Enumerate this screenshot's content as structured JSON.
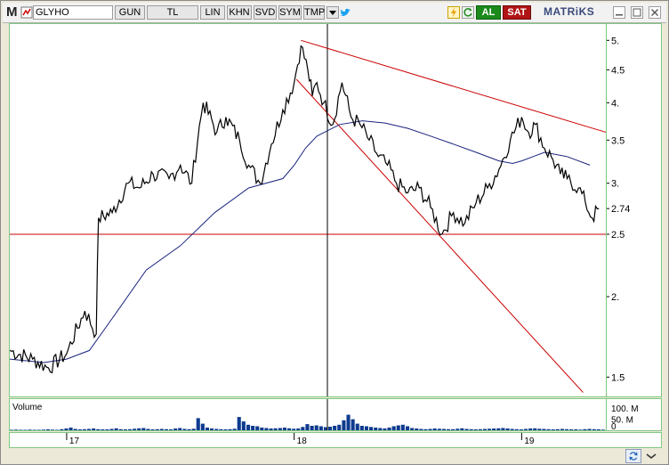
{
  "toolbar": {
    "logo": "M",
    "symbol": "GLYHO",
    "buttons": [
      "GUN",
      "TL",
      "LIN",
      "KHN",
      "SVD",
      "SYM",
      "TMP"
    ],
    "buy_label": "AL",
    "sell_label": "SAT",
    "brand": "MATRiKS"
  },
  "colors": {
    "price_line": "#000000",
    "moving_average": "#1a237e",
    "trend_lines": "#cc0000",
    "volume_bars": "#0d3b8e",
    "panel_border": "#7fc97f"
  },
  "chart_data": {
    "type": "line",
    "title": "",
    "xlabel": "",
    "ylabel": "",
    "price_axis_ticks": [
      "5.",
      "4.5",
      "4.",
      "3.5",
      "3.",
      "2.74",
      "2.5",
      "2.",
      "1.5"
    ],
    "time_axis_ticks": [
      "17",
      "18",
      "19"
    ],
    "last_price": 2.74,
    "support_level": 2.5,
    "y_scale": "log",
    "ylim": [
      1.4,
      5.3
    ],
    "series": [
      {
        "type": "price",
        "x": [
          2016.75,
          2016.85,
          2016.92,
          2017.0,
          2017.08,
          2017.13,
          2017.14,
          2017.2,
          2017.27,
          2017.32,
          2017.38,
          2017.45,
          2017.5,
          2017.55,
          2017.6,
          2017.66,
          2017.7,
          2017.76,
          2017.8,
          2017.85,
          2017.9,
          2017.95,
          2018.0,
          2018.03,
          2018.06,
          2018.08,
          2018.1,
          2018.13,
          2018.17,
          2018.21,
          2018.25,
          2018.29,
          2018.33,
          2018.37,
          2018.41,
          2018.45,
          2018.5,
          2018.55,
          2018.6,
          2018.65,
          2018.7,
          2018.75,
          2018.8,
          2018.85,
          2018.9,
          2018.95,
          2019.0,
          2019.03,
          2019.06,
          2019.1,
          2019.13,
          2019.17,
          2019.2,
          2019.25,
          2019.28,
          2019.31,
          2019.34
        ],
        "values": [
          1.65,
          1.6,
          1.55,
          1.63,
          1.9,
          1.75,
          2.65,
          2.7,
          3.0,
          2.95,
          3.1,
          3.05,
          3.2,
          3.0,
          4.0,
          3.6,
          3.8,
          3.5,
          3.2,
          3.0,
          3.45,
          3.9,
          4.3,
          4.9,
          4.5,
          4.1,
          4.3,
          4.0,
          3.7,
          4.3,
          3.8,
          3.7,
          3.5,
          3.3,
          3.2,
          3.0,
          2.9,
          2.95,
          2.75,
          2.5,
          2.7,
          2.6,
          2.8,
          2.95,
          3.15,
          3.5,
          3.8,
          3.6,
          3.7,
          3.4,
          3.3,
          3.1,
          3.05,
          2.95,
          2.8,
          2.65,
          2.74
        ]
      },
      {
        "type": "moving_average",
        "x": [
          2016.75,
          2016.9,
          2017.0,
          2017.1,
          2017.2,
          2017.35,
          2017.5,
          2017.65,
          2017.8,
          2017.95,
          2018.0,
          2018.05,
          2018.1,
          2018.2,
          2018.3,
          2018.4,
          2018.5,
          2018.6,
          2018.7,
          2018.8,
          2018.9,
          2018.96,
          2019.0,
          2019.05,
          2019.1,
          2019.2,
          2019.3
        ],
        "values": [
          1.6,
          1.58,
          1.6,
          1.65,
          1.85,
          2.2,
          2.4,
          2.7,
          2.95,
          3.05,
          3.2,
          3.4,
          3.55,
          3.7,
          3.75,
          3.72,
          3.65,
          3.55,
          3.45,
          3.35,
          3.25,
          3.22,
          3.25,
          3.3,
          3.35,
          3.3,
          3.2
        ]
      }
    ],
    "volume": {
      "ylabel": "Volume",
      "ticks": [
        "100. M",
        "50. M",
        "0"
      ],
      "ylim": [
        0,
        125
      ],
      "values": [
        2,
        3,
        2,
        2,
        3,
        2,
        2,
        3,
        4,
        3,
        2,
        5,
        8,
        12,
        6,
        4,
        5,
        6,
        8,
        5,
        4,
        4,
        6,
        9,
        5,
        4,
        5,
        7,
        9,
        10,
        6,
        4,
        5,
        6,
        5,
        4,
        8,
        10,
        6,
        5,
        7,
        55,
        30,
        12,
        8,
        6,
        5,
        4,
        5,
        7,
        60,
        40,
        25,
        20,
        18,
        12,
        10,
        8,
        9,
        10,
        12,
        9,
        7,
        8,
        15,
        28,
        20,
        22,
        18,
        14,
        16,
        20,
        25,
        45,
        70,
        50,
        30,
        20,
        18,
        15,
        12,
        10,
        8,
        12,
        18,
        22,
        25,
        18,
        10,
        8,
        6,
        5,
        6,
        8,
        7,
        6,
        5,
        5,
        7,
        9,
        6,
        5,
        4,
        5,
        6,
        7,
        8,
        9,
        10,
        8,
        6,
        5,
        4,
        6,
        8,
        9,
        7,
        6,
        5,
        4,
        5,
        6,
        5,
        4,
        4,
        3,
        5,
        6,
        5,
        4,
        3
      ]
    }
  }
}
